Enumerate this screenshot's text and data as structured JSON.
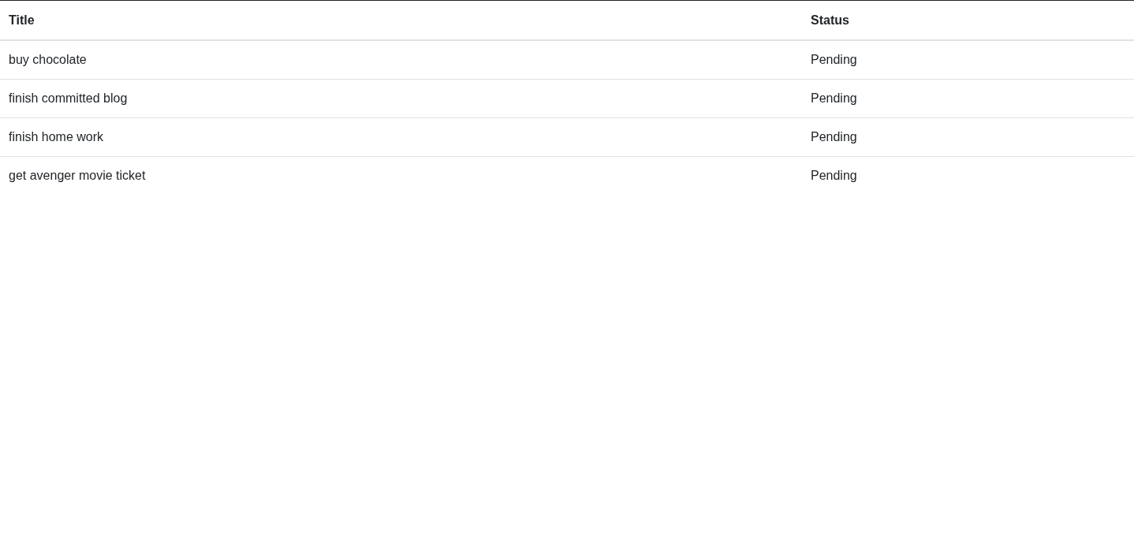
{
  "table": {
    "columns": [
      "Title",
      "Status"
    ],
    "rows": [
      {
        "title": "buy chocolate",
        "status": "Pending"
      },
      {
        "title": "finish committed blog",
        "status": "Pending"
      },
      {
        "title": "finish home work",
        "status": "Pending"
      },
      {
        "title": "get avenger movie ticket",
        "status": "Pending"
      }
    ]
  }
}
